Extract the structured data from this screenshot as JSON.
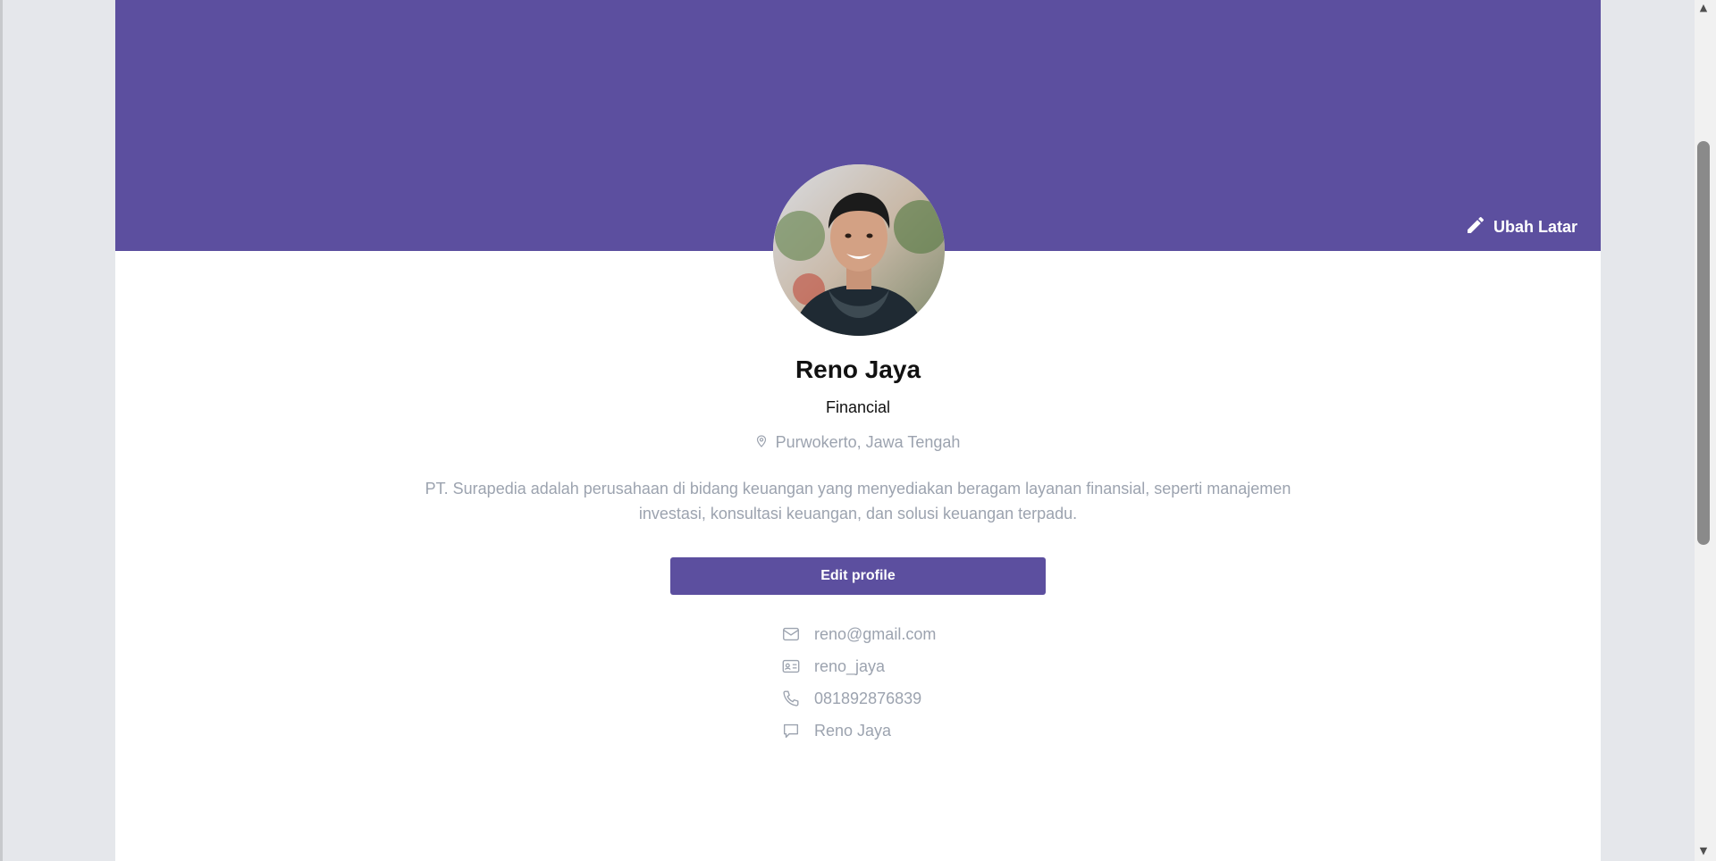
{
  "banner": {
    "color": "#5c4f9f",
    "change_bg_label": "Ubah Latar"
  },
  "profile": {
    "name": "Reno Jaya",
    "role": "Financial",
    "location": "Purwokerto, Jawa Tengah",
    "description": "PT. Surapedia adalah perusahaan di bidang keuangan yang menyediakan beragam layanan finansial, seperti manajemen investasi, konsultasi keuangan, dan solusi keuangan terpadu.",
    "edit_label": "Edit profile"
  },
  "contacts": {
    "email": "reno@gmail.com",
    "username": "reno_jaya",
    "phone": "081892876839",
    "chat": "Reno Jaya"
  },
  "scrollbar": {
    "up": "▲",
    "down": "▼"
  }
}
